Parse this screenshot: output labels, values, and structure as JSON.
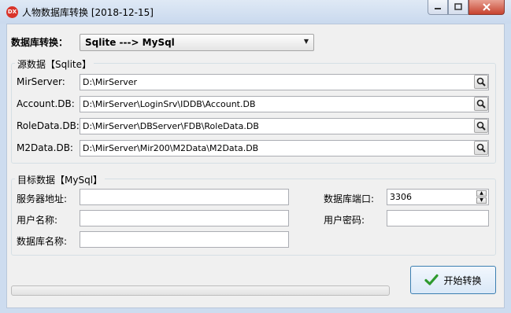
{
  "window": {
    "app_icon_text": "DX",
    "title": "人物数据库转换 [2018-12-15]"
  },
  "mode": {
    "label": "数据库转换：",
    "selected": "Sqlite ---> MySql"
  },
  "source": {
    "title": "源数据【Sqlite】",
    "fields": [
      {
        "label": "MirServer:",
        "value": "D:\\MirServer"
      },
      {
        "label": "Account.DB:",
        "value": "D:\\MirServer\\LoginSrv\\IDDB\\Account.DB"
      },
      {
        "label": "RoleData.DB:",
        "value": "D:\\MirServer\\DBServer\\FDB\\RoleData.DB"
      },
      {
        "label": "M2Data.DB:",
        "value": "D:\\MirServer\\Mir200\\M2Data\\M2Data.DB"
      }
    ]
  },
  "target": {
    "title": "目标数据【MySql】",
    "server_label": "服务器地址:",
    "server_value": "",
    "user_label": "用户名称:",
    "user_value": "",
    "dbname_label": "数据库名称:",
    "dbname_value": "",
    "port_label": "数据库端口:",
    "port_value": "3306",
    "password_label": "用户密码:",
    "password_value": ""
  },
  "progress": 0,
  "start_button": "开始转换",
  "colors": {
    "accent_border": "#3c7fb1",
    "close_button": "#c7432f",
    "check_icon": "#2e9a2e"
  }
}
